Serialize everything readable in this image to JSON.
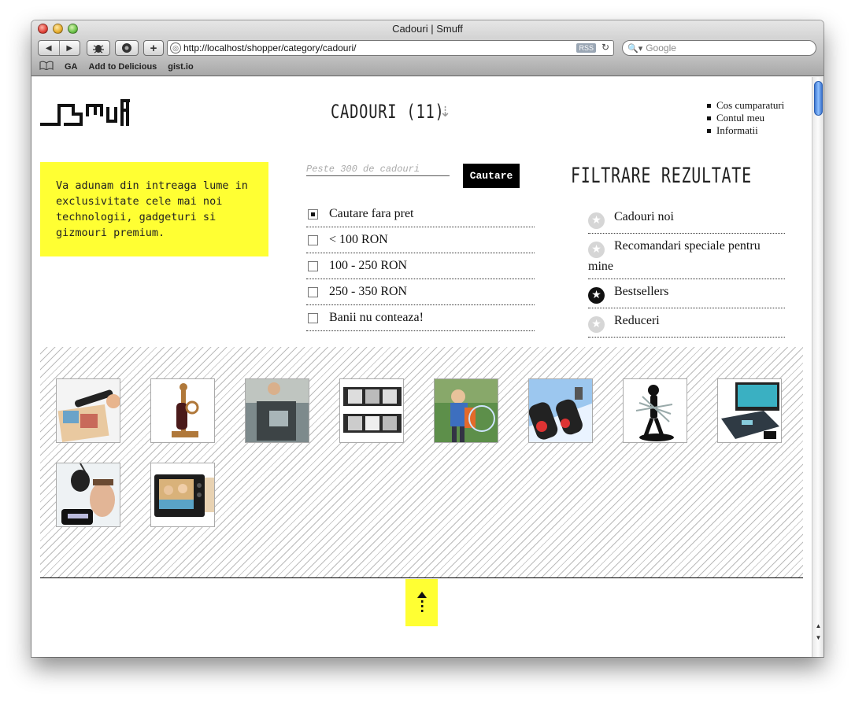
{
  "window": {
    "title": "Cadouri | Smuff"
  },
  "toolbar": {
    "url": "http://localhost/shopper/category/cadouri/",
    "rss_label": "RSS",
    "search_placeholder": "Google",
    "add_label": "+"
  },
  "bookmarks": [
    "GA",
    "Add to Delicious",
    "gist.io"
  ],
  "header": {
    "category_title": "CADOURI (11)",
    "menu": [
      "Cos cumparaturi",
      "Contul meu",
      "Informatii"
    ]
  },
  "promo": {
    "text": "Va adunam din intreaga lume in exclusivitate cele mai noi technologii, gadgeturi si gizmouri premium."
  },
  "search": {
    "placeholder": "Peste 300 de cadouri",
    "button": "Cautare"
  },
  "price_filters": [
    {
      "label": "Cautare fara pret",
      "checked": true
    },
    {
      "label": "< 100 RON",
      "checked": false
    },
    {
      "label": "100 - 250 RON",
      "checked": false
    },
    {
      "label": "250 - 350 RON",
      "checked": false
    },
    {
      "label": "Banii nu conteaza!",
      "checked": false
    }
  ],
  "filters": {
    "title": "FILTRARE REZULTATE",
    "items": [
      {
        "label": "Cadouri noi",
        "active": false
      },
      {
        "label": "Recomandari speciale pentru mine",
        "active": false
      },
      {
        "label": "Bestsellers",
        "active": true
      },
      {
        "label": "Reduceri",
        "active": false
      }
    ]
  },
  "products": [
    {
      "name": "scanner-pen"
    },
    {
      "name": "wine-bottle-puzzle"
    },
    {
      "name": "robot-gadget"
    },
    {
      "name": "photo-strip-frame"
    },
    {
      "name": "bubble-toy"
    },
    {
      "name": "keychain-gadget"
    },
    {
      "name": "knife-block-man"
    },
    {
      "name": "wifi-scale"
    },
    {
      "name": "camping-shower"
    },
    {
      "name": "digital-photo-frame"
    }
  ],
  "colors": {
    "accent": "#ffff33",
    "button": "#000000"
  }
}
